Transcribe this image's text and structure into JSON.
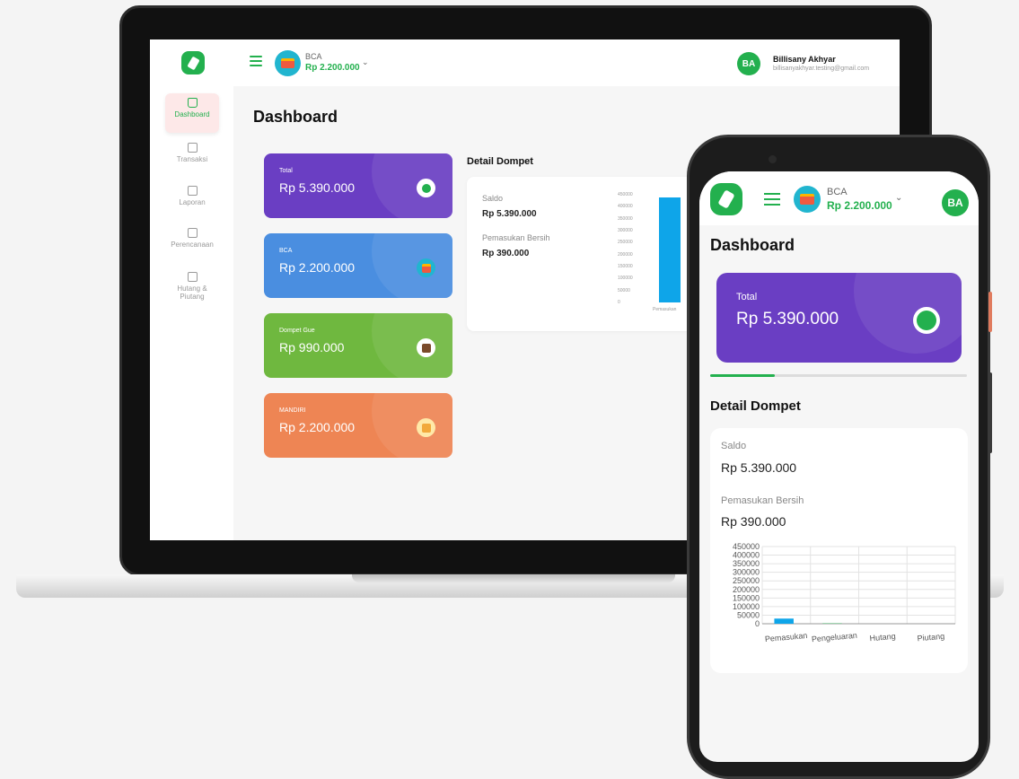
{
  "colors": {
    "brand": "#23b04e",
    "total_card": "#6a3ec3",
    "bca_card": "#4a8ee0",
    "dompet_card": "#6fb83f",
    "mandiri_card": "#ee8554",
    "bar": "#0ea5e9"
  },
  "header": {
    "wallet_name": "BCA",
    "wallet_amount": "Rp 2.200.000",
    "user_initials": "BA",
    "user_name": "Billisany Akhyar",
    "user_email": "billisanyakhyar.testing@gmail.com"
  },
  "sidebar": {
    "items": [
      {
        "label": "Dashboard",
        "icon": "home-icon"
      },
      {
        "label": "Transaksi",
        "icon": "receipt-icon"
      },
      {
        "label": "Laporan",
        "icon": "chart-icon"
      },
      {
        "label": "Perencanaan",
        "icon": "calendar-icon"
      },
      {
        "label": "Hutang &",
        "label2": "Piutang",
        "icon": "money-icon"
      }
    ]
  },
  "main": {
    "title": "Dashboard",
    "cards": [
      {
        "label": "Total",
        "amount": "Rp 5.390.000",
        "icon": "wallet-app-icon"
      },
      {
        "label": "BCA",
        "amount": "Rp 2.200.000",
        "icon": "id-card-icon"
      },
      {
        "label": "Dompet Gue",
        "amount": "Rp 990.000",
        "icon": "wallet-icon"
      },
      {
        "label": "MANDIRI",
        "amount": "Rp 2.200.000",
        "icon": "calculator-icon"
      }
    ],
    "detail_title": "Detail Dompet",
    "saldo_label": "Saldo",
    "saldo_value": "Rp 5.390.000",
    "pemasukan_label": "Pemasukan Bersih",
    "pemasukan_value": "Rp 390.000"
  },
  "mobile": {
    "title": "Dashboard",
    "card_label": "Total",
    "card_amount": "Rp 5.390.000",
    "carousel_progress": 0.25,
    "detail_title": "Detail Dompet",
    "saldo_label": "Saldo",
    "saldo_value": "Rp 5.390.000",
    "pemasukan_label": "Pemasukan Bersih",
    "pemasukan_value": "Rp 390.000"
  },
  "chart_data": [
    {
      "type": "bar",
      "categories": [
        "Pemasukan"
      ],
      "values": [
        440000
      ],
      "yticks": [
        "450000",
        "400000",
        "350000",
        "300000",
        "250000",
        "200000",
        "150000",
        "100000",
        "50000",
        "0"
      ],
      "ylim": [
        0,
        450000
      ]
    },
    {
      "type": "bar",
      "categories": [
        "Pemasukan",
        "Pengeluaran",
        "Hutang",
        "Piutang"
      ],
      "values": [
        30000,
        2000,
        0,
        0
      ],
      "yticks": [
        "450000",
        "400000",
        "350000",
        "300000",
        "250000",
        "200000",
        "150000",
        "100000",
        "50000",
        "0"
      ],
      "ylim": [
        0,
        450000
      ],
      "grid": true
    }
  ]
}
